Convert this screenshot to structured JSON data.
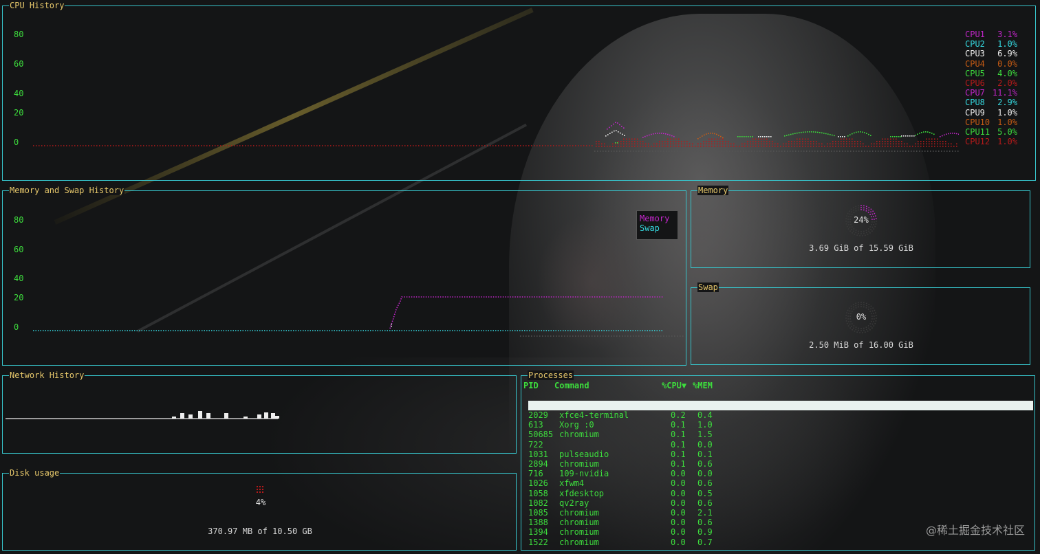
{
  "cpu": {
    "title": "CPU History",
    "y_ticks": [
      "80",
      "60",
      "40",
      "20",
      "0"
    ],
    "cores": [
      {
        "name": "CPU1",
        "value": "3.1%",
        "color": "#c126c8"
      },
      {
        "name": "CPU2",
        "value": "1.0%",
        "color": "#35d8df"
      },
      {
        "name": "CPU3",
        "value": "6.9%",
        "color": "#eeeeee"
      },
      {
        "name": "CPU4",
        "value": "0.0%",
        "color": "#c85c14"
      },
      {
        "name": "CPU5",
        "value": "4.0%",
        "color": "#3ddc3d"
      },
      {
        "name": "CPU6",
        "value": "2.0%",
        "color": "#b81a1a"
      },
      {
        "name": "CPU7",
        "value": "11.1%",
        "color": "#c126c8"
      },
      {
        "name": "CPU8",
        "value": "2.9%",
        "color": "#35d8df"
      },
      {
        "name": "CPU9",
        "value": "1.0%",
        "color": "#eeeeee"
      },
      {
        "name": "CPU10",
        "value": "1.0%",
        "color": "#c85c14"
      },
      {
        "name": "CPU11",
        "value": "5.0%",
        "color": "#3ddc3d"
      },
      {
        "name": "CPU12",
        "value": "1.0%",
        "color": "#b81a1a"
      }
    ]
  },
  "mem_history": {
    "title": "Memory and Swap History",
    "y_ticks": [
      "80",
      "60",
      "40",
      "20",
      "0"
    ],
    "legend": [
      {
        "label": "Memory",
        "color": "#c126c8"
      },
      {
        "label": "Swap",
        "color": "#35d8df"
      }
    ]
  },
  "memory": {
    "title": "Memory",
    "percent": "24%",
    "fraction": 0.24,
    "detail": "3.69 GiB of 15.59 GiB"
  },
  "swap": {
    "title": "Swap",
    "percent": "0%",
    "fraction": 0.0,
    "detail": "2.50 MiB of 16.00 GiB"
  },
  "network": {
    "title": "Network History"
  },
  "disk": {
    "title": "Disk usage",
    "percent": "4%",
    "detail": "370.97 MB of 10.50 GB"
  },
  "processes": {
    "title": "Processes",
    "headers": {
      "pid": "PID",
      "command": "Command",
      "cpu": "%CPU▼",
      "mem": "%MEM"
    },
    "rows": [
      {
        "pid": "2029",
        "command": "xfce4-terminal",
        "cpu": "0.2",
        "mem": "0.4"
      },
      {
        "pid": "613",
        "command": "Xorg :0",
        "cpu": "0.1",
        "mem": "1.0"
      },
      {
        "pid": "50685",
        "command": "chromium",
        "cpu": "0.1",
        "mem": "1.5"
      },
      {
        "pid": "722",
        "command": "",
        "cpu": "0.1",
        "mem": "0.0"
      },
      {
        "pid": "1031",
        "command": "pulseaudio",
        "cpu": "0.1",
        "mem": "0.1"
      },
      {
        "pid": "2894",
        "command": "chromium",
        "cpu": "0.1",
        "mem": "0.6"
      },
      {
        "pid": "716",
        "command": "109-nvidia",
        "cpu": "0.0",
        "mem": "0.0"
      },
      {
        "pid": "1026",
        "command": "xfwm4",
        "cpu": "0.0",
        "mem": "0.6"
      },
      {
        "pid": "1058",
        "command": "xfdesktop",
        "cpu": "0.0",
        "mem": "0.5"
      },
      {
        "pid": "1082",
        "command": "qv2ray",
        "cpu": "0.0",
        "mem": "0.6"
      },
      {
        "pid": "1085",
        "command": "chromium",
        "cpu": "0.0",
        "mem": "2.1"
      },
      {
        "pid": "1388",
        "command": "chromium",
        "cpu": "0.0",
        "mem": "0.6"
      },
      {
        "pid": "1394",
        "command": "chromium",
        "cpu": "0.0",
        "mem": "0.9"
      },
      {
        "pid": "1522",
        "command": "chromium",
        "cpu": "0.0",
        "mem": "0.7"
      }
    ]
  },
  "watermark": "@稀土掘金技术社区"
}
